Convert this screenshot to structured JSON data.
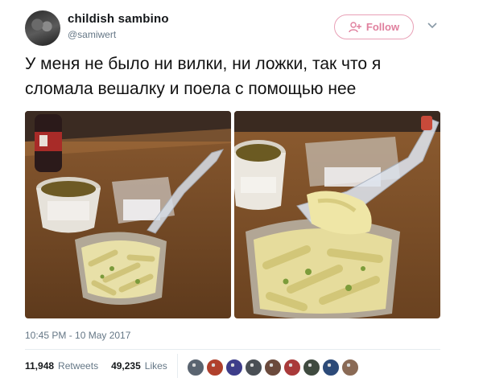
{
  "user": {
    "display_name": "childish sambino",
    "handle": "@samiwert",
    "avatar_icon": "user-avatar"
  },
  "follow_button": {
    "label": "Follow",
    "icon": "add-user-icon",
    "color": "#e0809e"
  },
  "menu_icon": "chevron-down-icon",
  "tweet": {
    "text_line1": "У меня не было ни вилки, ни ложки, так что я",
    "text_line2": "сломала вешалку и поела с помощью нее"
  },
  "media": [
    {
      "alt": "photo-pasta-hanger-left"
    },
    {
      "alt": "photo-pasta-hanger-right"
    }
  ],
  "timestamp": "10:45 PM - 10 May 2017",
  "stats": {
    "retweets_count": "11,948",
    "retweets_label": "Retweets",
    "likes_count": "49,235",
    "likes_label": "Likes"
  },
  "likers": [
    {
      "color": "#5a6470"
    },
    {
      "color": "#b0402c"
    },
    {
      "color": "#3d3d8a"
    },
    {
      "color": "#4a4f55"
    },
    {
      "color": "#6b4a3c"
    },
    {
      "color": "#a93a3a"
    },
    {
      "color": "#3f4a3f"
    },
    {
      "color": "#2c4a78"
    },
    {
      "color": "#8a6a55"
    }
  ]
}
